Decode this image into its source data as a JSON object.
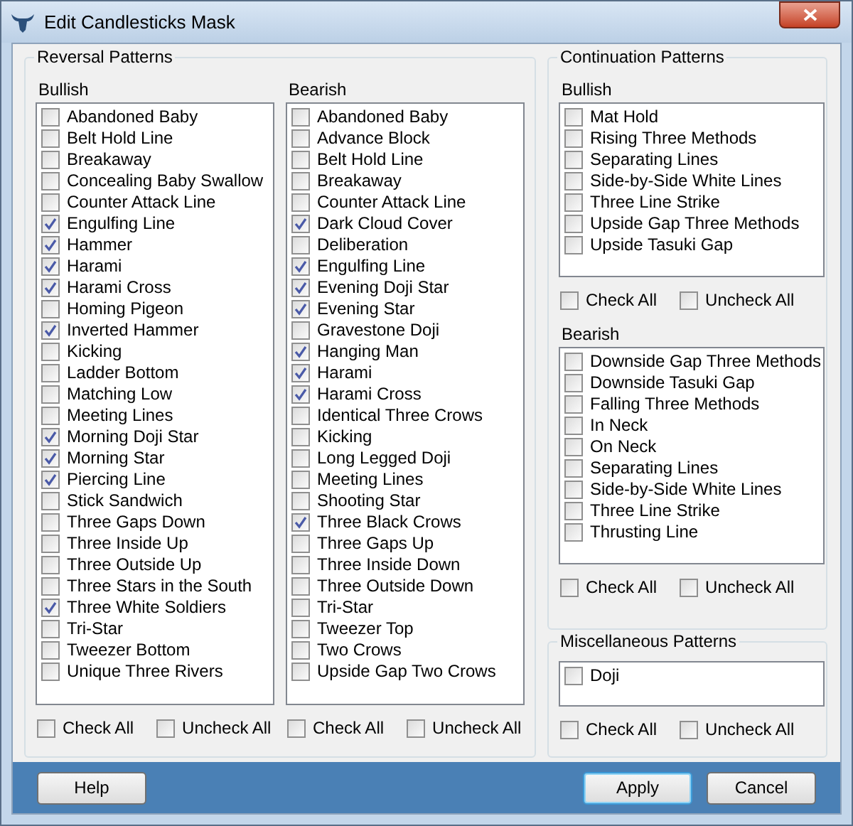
{
  "window": {
    "title": "Edit Candlesticks Mask"
  },
  "reversal": {
    "title": "Reversal Patterns",
    "lists": [
      {
        "label": "Bullish",
        "items": [
          {
            "label": "Abandoned Baby",
            "checked": false
          },
          {
            "label": "Belt Hold Line",
            "checked": false
          },
          {
            "label": "Breakaway",
            "checked": false
          },
          {
            "label": "Concealing Baby Swallow",
            "checked": false
          },
          {
            "label": "Counter Attack Line",
            "checked": false
          },
          {
            "label": "Engulfing Line",
            "checked": true
          },
          {
            "label": "Hammer",
            "checked": true
          },
          {
            "label": "Harami",
            "checked": true
          },
          {
            "label": "Harami Cross",
            "checked": true
          },
          {
            "label": "Homing Pigeon",
            "checked": false
          },
          {
            "label": "Inverted Hammer",
            "checked": true
          },
          {
            "label": "Kicking",
            "checked": false
          },
          {
            "label": "Ladder Bottom",
            "checked": false
          },
          {
            "label": "Matching Low",
            "checked": false
          },
          {
            "label": "Meeting Lines",
            "checked": false
          },
          {
            "label": "Morning Doji Star",
            "checked": true
          },
          {
            "label": "Morning Star",
            "checked": true
          },
          {
            "label": "Piercing Line",
            "checked": true
          },
          {
            "label": "Stick Sandwich",
            "checked": false
          },
          {
            "label": "Three Gaps Down",
            "checked": false
          },
          {
            "label": "Three Inside Up",
            "checked": false
          },
          {
            "label": "Three Outside Up",
            "checked": false
          },
          {
            "label": "Three Stars in the South",
            "checked": false
          },
          {
            "label": "Three White Soldiers",
            "checked": true
          },
          {
            "label": "Tri-Star",
            "checked": false
          },
          {
            "label": "Tweezer Bottom",
            "checked": false
          },
          {
            "label": "Unique Three Rivers",
            "checked": false
          }
        ],
        "check_all": {
          "label": "Check All",
          "checked": false
        },
        "uncheck_all": {
          "label": "Uncheck All",
          "checked": false
        }
      },
      {
        "label": "Bearish",
        "items": [
          {
            "label": "Abandoned Baby",
            "checked": false
          },
          {
            "label": "Advance Block",
            "checked": false
          },
          {
            "label": "Belt Hold Line",
            "checked": false
          },
          {
            "label": "Breakaway",
            "checked": false
          },
          {
            "label": "Counter Attack Line",
            "checked": false
          },
          {
            "label": "Dark Cloud Cover",
            "checked": true
          },
          {
            "label": "Deliberation",
            "checked": false
          },
          {
            "label": "Engulfing Line",
            "checked": true
          },
          {
            "label": "Evening Doji Star",
            "checked": true
          },
          {
            "label": "Evening Star",
            "checked": true
          },
          {
            "label": "Gravestone Doji",
            "checked": false
          },
          {
            "label": "Hanging Man",
            "checked": true
          },
          {
            "label": "Harami",
            "checked": true
          },
          {
            "label": "Harami Cross",
            "checked": true
          },
          {
            "label": "Identical Three Crows",
            "checked": false
          },
          {
            "label": "Kicking",
            "checked": false
          },
          {
            "label": "Long Legged Doji",
            "checked": false
          },
          {
            "label": "Meeting Lines",
            "checked": false
          },
          {
            "label": "Shooting Star",
            "checked": false
          },
          {
            "label": "Three Black Crows",
            "checked": true
          },
          {
            "label": "Three Gaps Up",
            "checked": false
          },
          {
            "label": "Three Inside Down",
            "checked": false
          },
          {
            "label": "Three Outside Down",
            "checked": false
          },
          {
            "label": "Tri-Star",
            "checked": false
          },
          {
            "label": "Tweezer Top",
            "checked": false
          },
          {
            "label": "Two Crows",
            "checked": false
          },
          {
            "label": "Upside Gap Two Crows",
            "checked": false
          }
        ],
        "check_all": {
          "label": "Check All",
          "checked": false
        },
        "uncheck_all": {
          "label": "Uncheck All",
          "checked": false
        }
      }
    ]
  },
  "continuation": {
    "title": "Continuation Patterns",
    "lists": [
      {
        "label": "Bullish",
        "items": [
          {
            "label": "Mat Hold",
            "checked": false
          },
          {
            "label": "Rising Three Methods",
            "checked": false
          },
          {
            "label": "Separating Lines",
            "checked": false
          },
          {
            "label": "Side-by-Side White Lines",
            "checked": false
          },
          {
            "label": "Three Line Strike",
            "checked": false
          },
          {
            "label": "Upside Gap Three Methods",
            "checked": false
          },
          {
            "label": "Upside Tasuki Gap",
            "checked": false
          }
        ],
        "check_all": {
          "label": "Check All",
          "checked": false
        },
        "uncheck_all": {
          "label": "Uncheck All",
          "checked": false
        }
      },
      {
        "label": "Bearish",
        "items": [
          {
            "label": "Downside Gap Three Methods",
            "checked": false
          },
          {
            "label": "Downside Tasuki Gap",
            "checked": false
          },
          {
            "label": "Falling Three Methods",
            "checked": false
          },
          {
            "label": "In Neck",
            "checked": false
          },
          {
            "label": "On Neck",
            "checked": false
          },
          {
            "label": "Separating Lines",
            "checked": false
          },
          {
            "label": "Side-by-Side White Lines",
            "checked": false
          },
          {
            "label": "Three Line Strike",
            "checked": false
          },
          {
            "label": "Thrusting Line",
            "checked": false
          }
        ],
        "check_all": {
          "label": "Check All",
          "checked": false
        },
        "uncheck_all": {
          "label": "Uncheck All",
          "checked": false
        }
      }
    ]
  },
  "miscellaneous": {
    "title": "Miscellaneous Patterns",
    "lists": [
      {
        "items": [
          {
            "label": "Doji",
            "checked": false
          }
        ],
        "check_all": {
          "label": "Check All",
          "checked": false
        },
        "uncheck_all": {
          "label": "Uncheck All",
          "checked": false
        }
      }
    ]
  },
  "buttons": [
    {
      "label": "Help",
      "default": false
    },
    {
      "label": "Apply",
      "default": true
    },
    {
      "label": "Cancel",
      "default": false
    }
  ]
}
